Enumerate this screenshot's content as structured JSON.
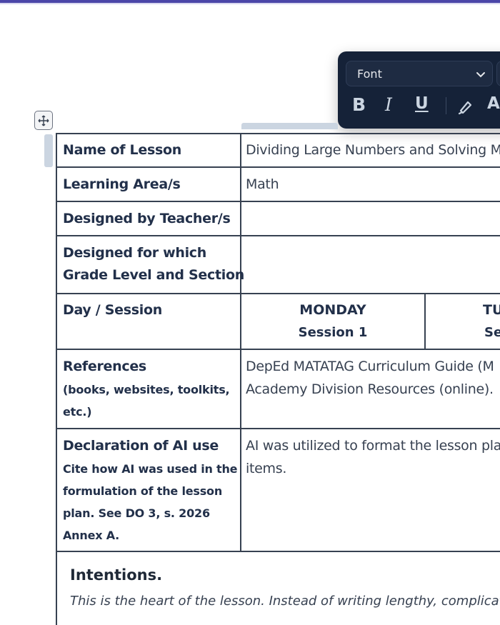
{
  "toolbar": {
    "font_label": "Font",
    "bold": "B",
    "italic": "I",
    "underline": "U",
    "text_color": "A",
    "icons": [
      "chevron-down-icon",
      "highlighter-icon"
    ]
  },
  "table": {
    "rows": [
      {
        "label": "Name of Lesson",
        "value": "Dividing Large Numbers and Solving M"
      },
      {
        "label": "Learning Area/s",
        "value": "Math"
      },
      {
        "label": "Designed by Teacher/s",
        "value": ""
      },
      {
        "label_lines": [
          "Designed for which",
          "Grade Level and Section"
        ],
        "value": ""
      },
      {
        "label": "Day / Session"
      },
      {
        "label": "References",
        "sub": [
          "(books, websites, toolkits,",
          "etc.)"
        ],
        "value_lines": [
          "DepEd MATATAG Curriculum Guide (M",
          "Academy Division Resources (online)."
        ]
      },
      {
        "label": "Declaration of AI use",
        "sub": [
          "Cite how AI was used in the",
          "formulation of the lesson",
          "plan. See DO 3, s. 2026",
          "Annex A."
        ],
        "value_lines": [
          "AI was utilized to format the lesson pla",
          "items."
        ]
      }
    ],
    "days": [
      {
        "day": "MONDAY",
        "session": "Session 1"
      },
      {
        "day": "TU",
        "session": "Se"
      }
    ]
  },
  "intentions": {
    "title": "Intentions.",
    "desc": "This is the heart of the lesson. Instead of writing lengthy, complicate"
  },
  "colors": {
    "toolbar_bg": "#152238",
    "accent_bar": "#4b46a8",
    "table_border": "#374151"
  }
}
